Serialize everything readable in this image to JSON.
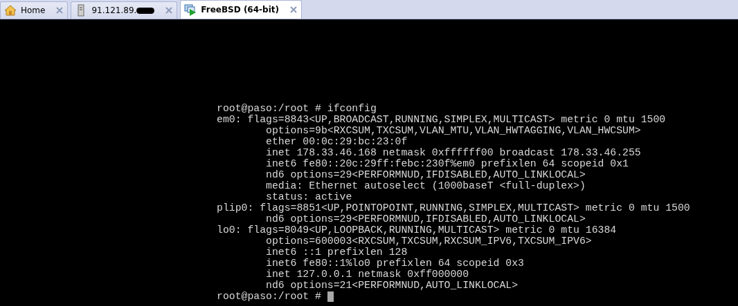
{
  "tabs": [
    {
      "kind": "home",
      "label": "Home",
      "selected": false,
      "redacted": false
    },
    {
      "kind": "server",
      "label": "91.121.89.",
      "selected": false,
      "redacted": true
    },
    {
      "kind": "vm",
      "label": "FreeBSD (64-bit)",
      "selected": true,
      "redacted": false
    }
  ],
  "console": {
    "lines": [
      "root@paso:/root # ifconfig",
      "em0: flags=8843<UP,BROADCAST,RUNNING,SIMPLEX,MULTICAST> metric 0 mtu 1500",
      "        options=9b<RXCSUM,TXCSUM,VLAN_MTU,VLAN_HWTAGGING,VLAN_HWCSUM>",
      "        ether 00:0c:29:bc:23:0f",
      "        inet 178.33.46.168 netmask 0xffffff00 broadcast 178.33.46.255",
      "        inet6 fe80::20c:29ff:febc:230f%em0 prefixlen 64 scopeid 0x1",
      "        nd6 options=29<PERFORMNUD,IFDISABLED,AUTO_LINKLOCAL>",
      "        media: Ethernet autoselect (1000baseT <full-duplex>)",
      "        status: active",
      "plip0: flags=8851<UP,POINTOPOINT,RUNNING,SIMPLEX,MULTICAST> metric 0 mtu 1500",
      "        nd6 options=29<PERFORMNUD,IFDISABLED,AUTO_LINKLOCAL>",
      "lo0: flags=8049<UP,LOOPBACK,RUNNING,MULTICAST> metric 0 mtu 16384",
      "        options=600003<RXCSUM,TXCSUM,RXCSUM_IPV6,TXCSUM_IPV6>",
      "        inet6 ::1 prefixlen 128",
      "        inet6 fe80::1%lo0 prefixlen 64 scopeid 0x3",
      "        inet 127.0.0.1 netmask 0xff000000",
      "        nd6 options=21<PERFORMNUD,AUTO_LINKLOCAL>"
    ],
    "prompt": "root@paso:/root #"
  }
}
